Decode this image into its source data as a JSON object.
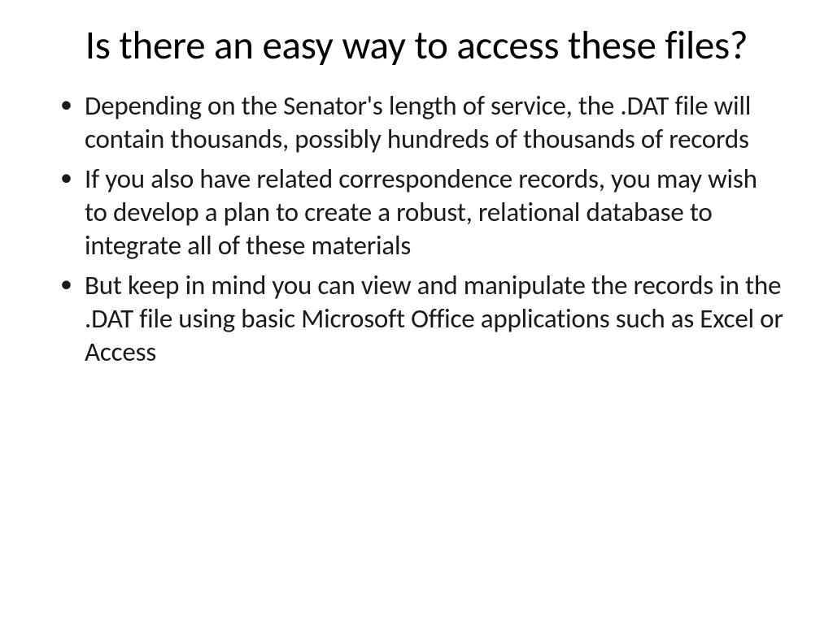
{
  "slide": {
    "title": "Is there an easy way to access these files?",
    "bullets": [
      "Depending on the Senator's length of service, the .DAT file will contain thousands, possibly hundreds of thousands of records",
      "If you also have related correspondence records, you may wish to develop a plan to create a robust, relational database to integrate all of these materials",
      "But keep in mind you can view and manipulate the records in the .DAT file using basic Microsoft Office applications such as Excel or Access"
    ]
  }
}
